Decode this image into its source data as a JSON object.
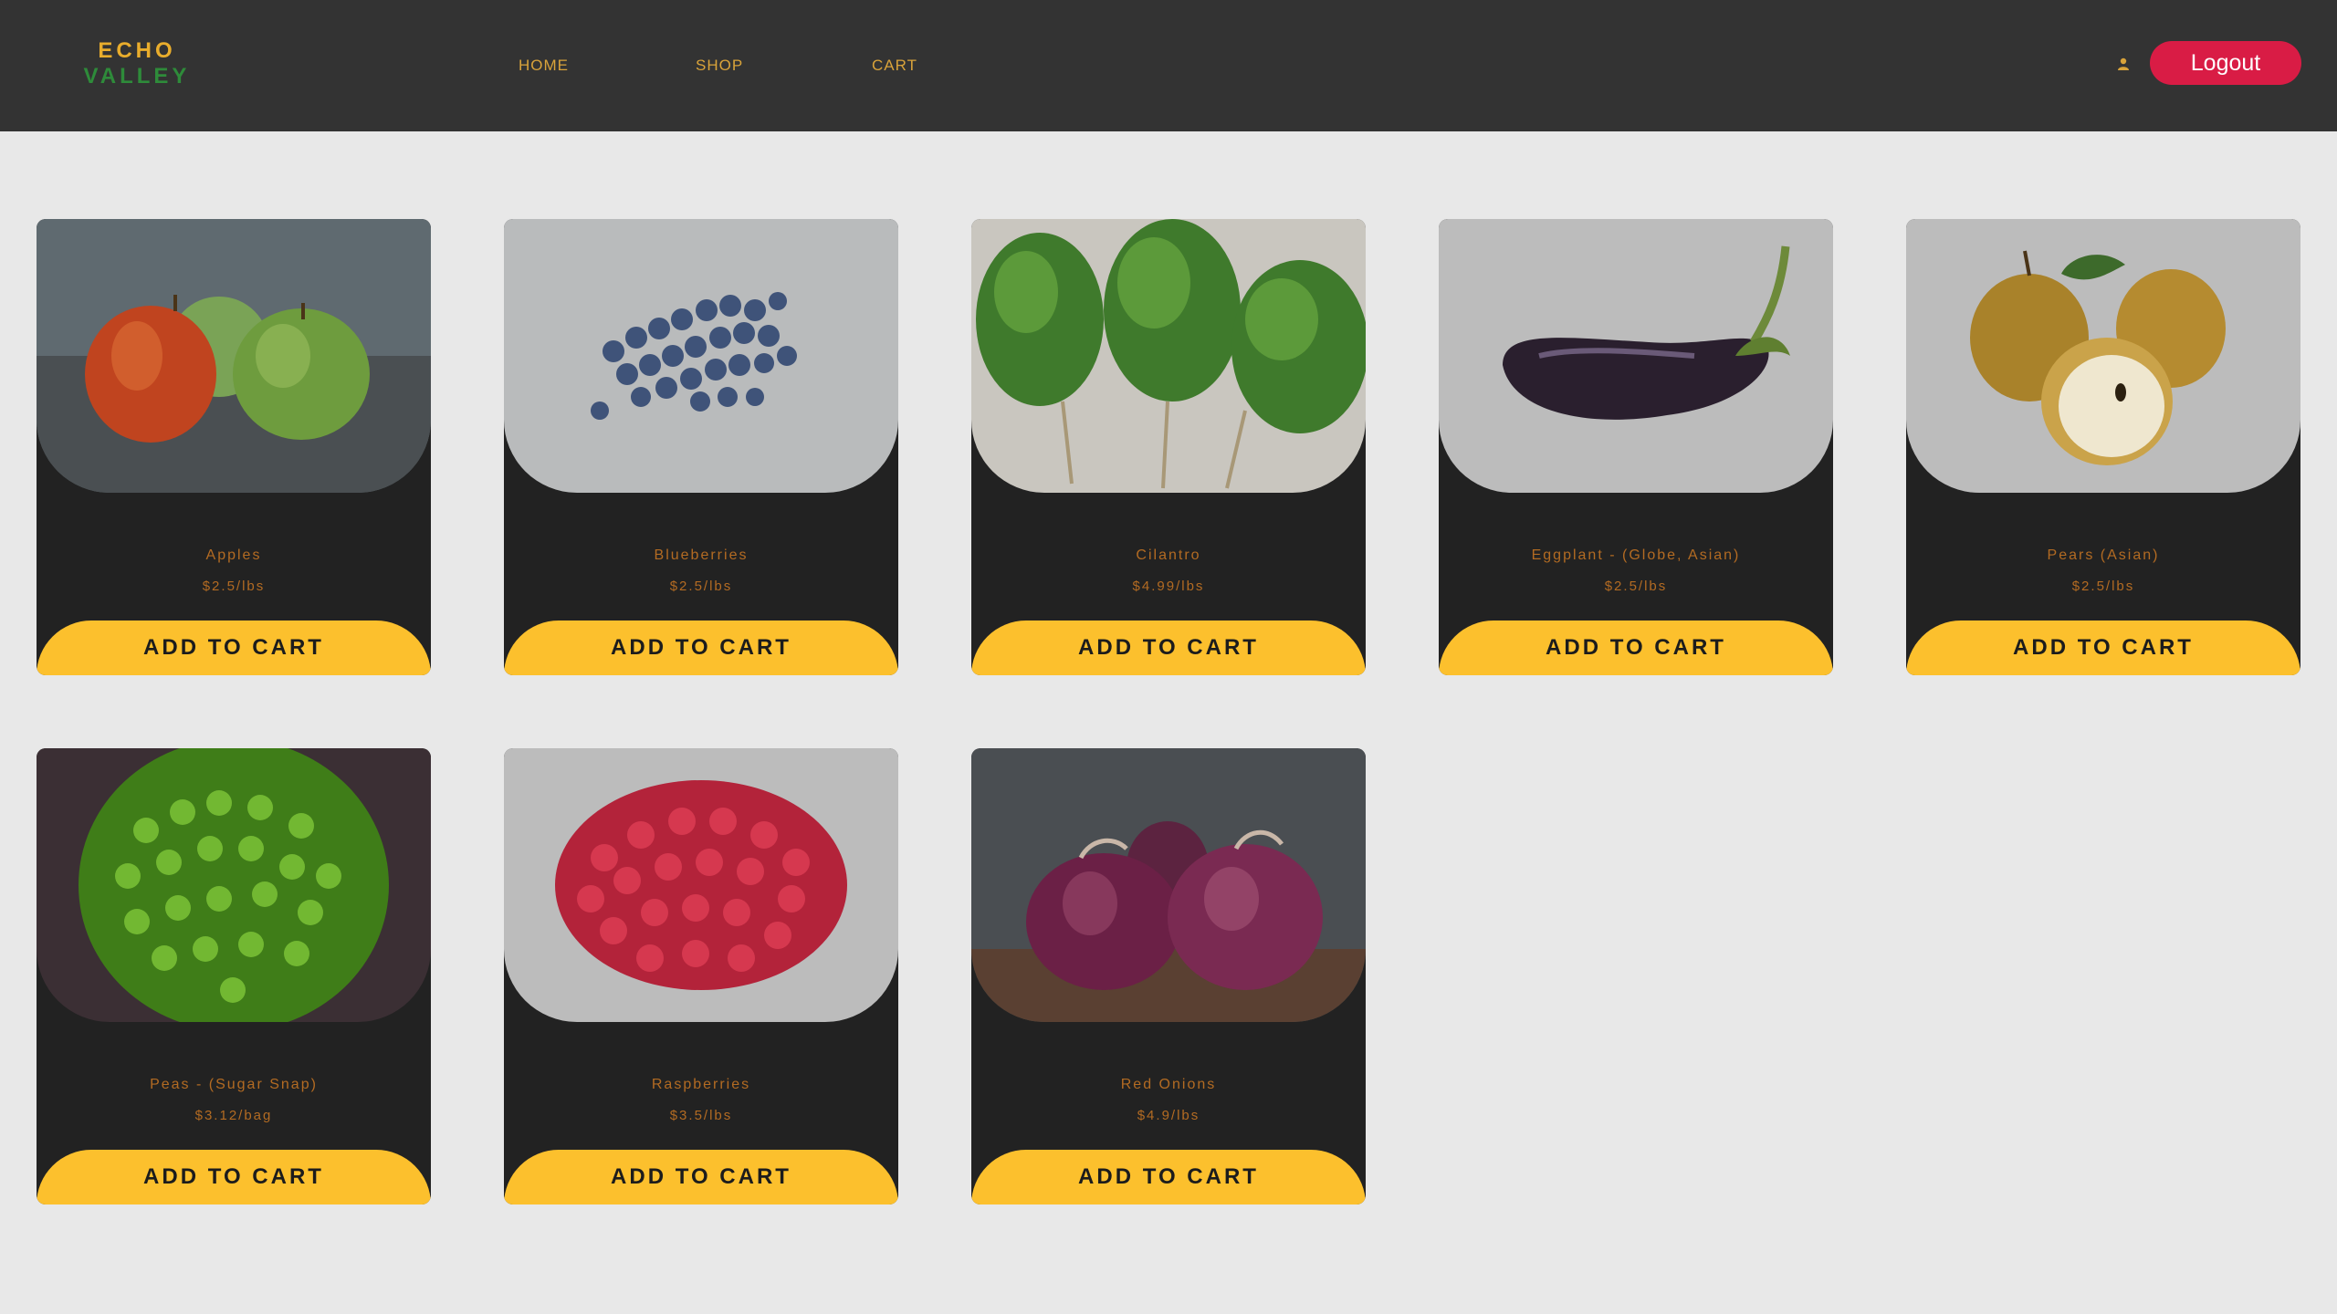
{
  "brand": {
    "line1": "ECHO",
    "line2": "VALLEY"
  },
  "nav": [
    {
      "label": "HOME"
    },
    {
      "label": "SHOP"
    },
    {
      "label": "CART"
    }
  ],
  "header": {
    "user_icon": "user-icon",
    "logout_label": "Logout"
  },
  "colors": {
    "header_bg": "#333333",
    "page_bg": "#e8e8e8",
    "card_bg": "#222222",
    "accent_yellow": "#fcc02d",
    "logout_red": "#d91c45",
    "brand_green": "#2e8b3a",
    "text_orange": "#b36b22"
  },
  "products": [
    {
      "name": "Apples",
      "price": "$2.5/lbs",
      "button": "ADD TO CART",
      "image": "apples-image"
    },
    {
      "name": "Blueberries",
      "price": "$2.5/lbs",
      "button": "ADD TO CART",
      "image": "blueberries-image"
    },
    {
      "name": "Cilantro",
      "price": "$4.99/lbs",
      "button": "ADD TO CART",
      "image": "cilantro-image"
    },
    {
      "name": "Eggplant - (Globe, Asian)",
      "price": "$2.5/lbs",
      "button": "ADD TO CART",
      "image": "eggplant-image"
    },
    {
      "name": "Pears (Asian)",
      "price": "$2.5/lbs",
      "button": "ADD TO CART",
      "image": "pears-image"
    },
    {
      "name": "Peas - (Sugar Snap)",
      "price": "$3.12/bag",
      "button": "ADD TO CART",
      "image": "peas-image"
    },
    {
      "name": "Raspberries",
      "price": "$3.5/lbs",
      "button": "ADD TO CART",
      "image": "raspberries-image"
    },
    {
      "name": "Red Onions",
      "price": "$4.9/lbs",
      "button": "ADD TO CART",
      "image": "red-onions-image"
    }
  ]
}
